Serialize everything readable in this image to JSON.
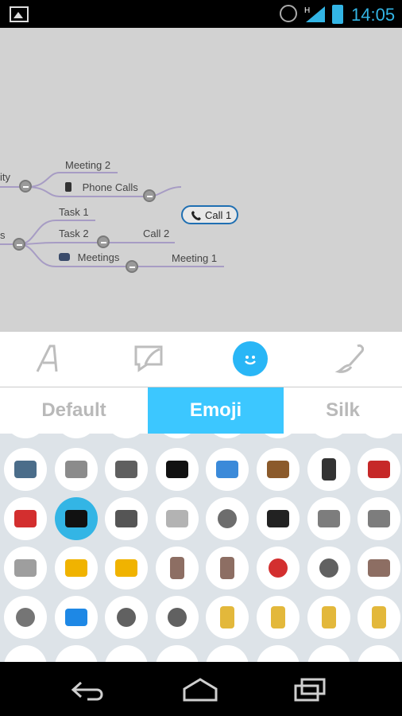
{
  "status_bar": {
    "time": "14:05",
    "icons": [
      "image-notification-icon",
      "alarm-icon",
      "signal-icon",
      "battery-icon"
    ]
  },
  "mindmap": {
    "partial_left_1": "ity",
    "partial_left_2": "s",
    "nodes": {
      "meeting2": "Meeting 2",
      "phone_calls": "Phone Calls",
      "call1": "Call 1",
      "task1": "Task 1",
      "task2": "Task 2",
      "call2": "Call 2",
      "meetings": "Meetings",
      "meeting1": "Meeting 1"
    }
  },
  "toolbar": {
    "items": [
      "text-style-icon",
      "callout-icon",
      "emoji-smiley-icon",
      "brush-icon"
    ],
    "active_index": 2
  },
  "tabs": {
    "items": [
      "Default",
      "Emoji",
      "Silk"
    ],
    "active": "Emoji"
  },
  "emoji_grid": {
    "rows": [
      [
        "floppy-disk",
        "camera",
        "video-camera",
        "movie-camera",
        "computer",
        "television",
        "mobile-phone",
        "telephone"
      ],
      [
        "telephone-red",
        "telephone-receiver",
        "pager",
        "fax",
        "cd",
        "videocassette",
        "speaker",
        "speaker-loud"
      ],
      [
        "muted-speaker",
        "megaphone",
        "loudspeaker",
        "hourglass",
        "hourglass-flowing",
        "alarm-clock",
        "watch",
        "radio"
      ],
      [
        "satellite-antenna",
        "voicemail",
        "magnifier-left",
        "magnifier-right",
        "unlocked",
        "locked",
        "lock-with-pen",
        "lock-with-key"
      ]
    ],
    "selected": "telephone-receiver"
  },
  "nav": [
    "back-icon",
    "home-icon",
    "recent-apps-icon"
  ],
  "colors": {
    "accent": "#33b5e5",
    "tab_active": "#3cc7ff",
    "canvas": "#d2d2d2",
    "grid_bg": "#dde3e8"
  }
}
